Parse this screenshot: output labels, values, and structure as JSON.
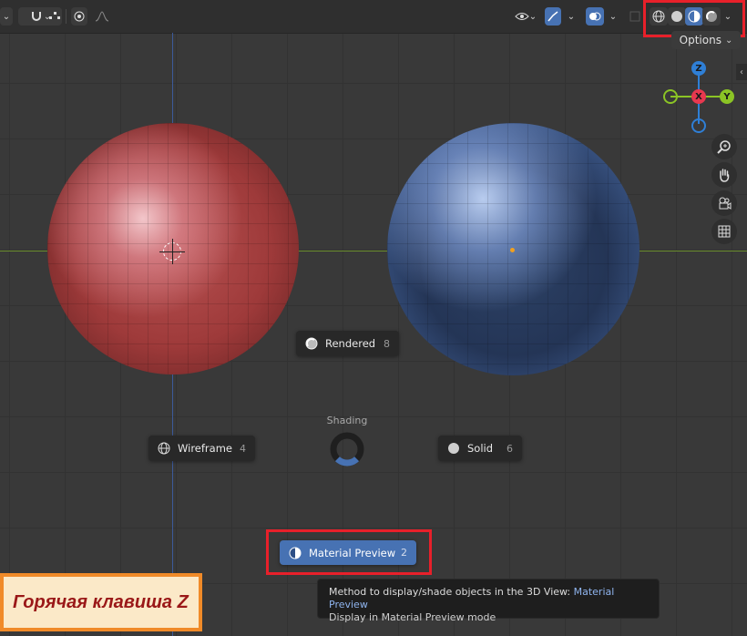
{
  "header": {
    "options_label": "Options",
    "shading_modes": [
      {
        "name": "wireframe",
        "active": false
      },
      {
        "name": "solid",
        "active": false
      },
      {
        "name": "material-preview",
        "active": true
      },
      {
        "name": "rendered",
        "active": false
      }
    ]
  },
  "gizmo": {
    "x": "X",
    "y": "Y",
    "z": "Z"
  },
  "pie_menu": {
    "title": "Shading",
    "items": {
      "rendered": {
        "label": "Rendered",
        "key": "8"
      },
      "wireframe": {
        "label": "Wireframe",
        "key": "4"
      },
      "solid": {
        "label": "Solid",
        "key": "6"
      },
      "material_preview": {
        "label": "Material Preview",
        "key": "2"
      }
    }
  },
  "tooltip": {
    "prefix": "Method to display/shade objects in the 3D View:",
    "highlight": "Material Preview",
    "subtitle": "Display in Material Preview mode"
  },
  "annotation": {
    "hotkey_text": "Горячая клавиша Z"
  },
  "colors": {
    "accent_blue": "#4772b3",
    "highlight_red": "#e8202a",
    "x_axis": "#e8384f",
    "y_axis": "#8bc425",
    "z_axis": "#2f7fd6",
    "annotation_border": "#f08a28",
    "annotation_bg": "#fbe9c8",
    "annotation_text": "#9a1818"
  }
}
